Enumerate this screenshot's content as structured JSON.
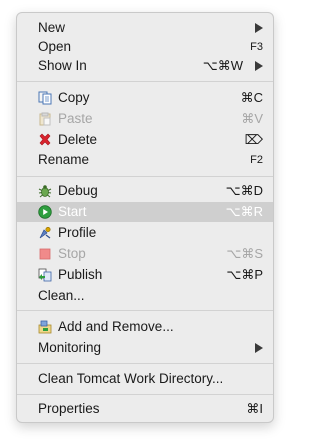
{
  "menu": {
    "new": {
      "label": "New"
    },
    "open": {
      "label": "Open",
      "shortcut": "F3"
    },
    "show_in": {
      "label": "Show In",
      "shortcut": "⌥⌘W"
    },
    "copy": {
      "label": "Copy",
      "shortcut": "⌘C"
    },
    "paste": {
      "label": "Paste",
      "shortcut": "⌘V"
    },
    "delete": {
      "label": "Delete",
      "shortcut": "⌦"
    },
    "rename": {
      "label": "Rename",
      "shortcut": "F2"
    },
    "debug": {
      "label": "Debug",
      "shortcut": "⌥⌘D"
    },
    "start": {
      "label": "Start",
      "shortcut": "⌥⌘R"
    },
    "profile": {
      "label": "Profile"
    },
    "stop": {
      "label": "Stop",
      "shortcut": "⌥⌘S"
    },
    "publish": {
      "label": "Publish",
      "shortcut": "⌥⌘P"
    },
    "clean": {
      "label": "Clean..."
    },
    "add_remove": {
      "label": "Add and Remove..."
    },
    "monitoring": {
      "label": "Monitoring"
    },
    "clean_tomcat": {
      "label": "Clean Tomcat Work Directory..."
    },
    "properties": {
      "label": "Properties",
      "shortcut": "⌘I"
    }
  },
  "icons": {
    "copy": "copy-icon",
    "paste": "paste-icon",
    "delete": "delete-icon",
    "debug": "debug-bug-icon",
    "start": "start-play-icon",
    "profile": "profile-icon",
    "stop": "stop-icon",
    "publish": "publish-icon",
    "add_remove": "add-remove-icon"
  },
  "colors": {
    "menu_background": "#ececec",
    "selected_row": "#cfcfcf",
    "disabled_text": "#a6a6a6",
    "delete_red": "#d9232d",
    "start_green": "#2e9e3e"
  }
}
